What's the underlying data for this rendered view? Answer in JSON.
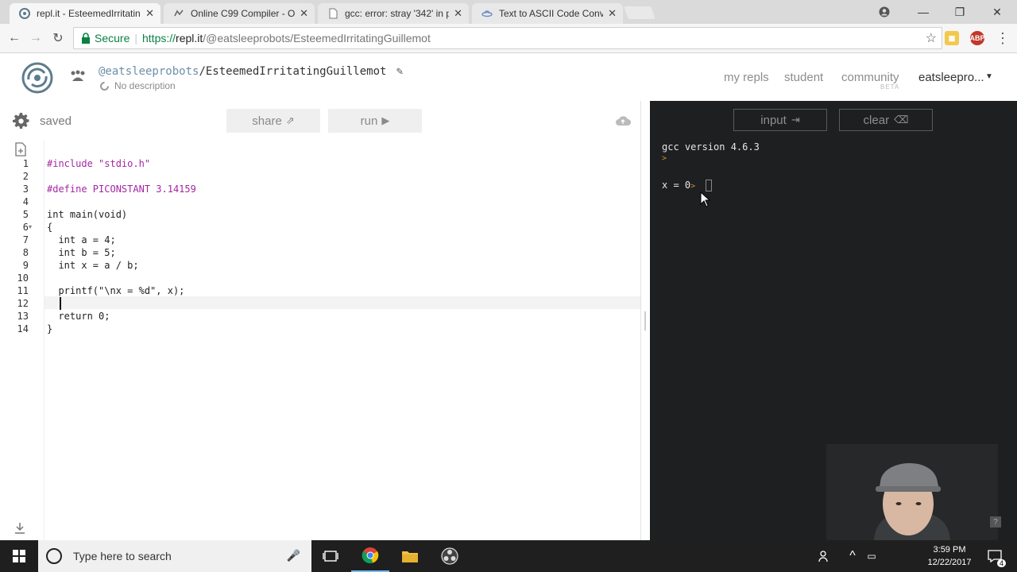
{
  "browser": {
    "tabs": [
      {
        "title": "repl.it - EsteemedIrritatin",
        "icon": "replit-icon"
      },
      {
        "title": "Online C99 Compiler - O",
        "icon": "compiler-icon"
      },
      {
        "title": "gcc: error: stray '342' in p",
        "icon": "doc-icon"
      },
      {
        "title": "Text to ASCII Code Conv",
        "icon": "ufo-icon"
      }
    ],
    "secure_label": "Secure",
    "url_prefix": "https://",
    "url_host": "repl.it",
    "url_path": "/@eatsleeprobots/EsteemedIrritatingGuillemot",
    "ext_abp": "ABP"
  },
  "header": {
    "owner": "@eatsleeprobots",
    "repl_name": "EsteemedIrritatingGuillemot",
    "description": "No description",
    "nav": {
      "my_repls": "my repls",
      "student": "student",
      "community": "community",
      "community_badge": "BETA",
      "user": "eatsleepro..."
    }
  },
  "editor": {
    "status": "saved",
    "share_label": "share",
    "run_label": "run",
    "lines": [
      {
        "n": "1",
        "text": "#include \"stdio.h\""
      },
      {
        "n": "2",
        "text": ""
      },
      {
        "n": "3",
        "text": "#define PICONSTANT 3.14159"
      },
      {
        "n": "4",
        "text": ""
      },
      {
        "n": "5",
        "text": "int main(void)"
      },
      {
        "n": "6",
        "text": "{"
      },
      {
        "n": "7",
        "text": "  int a = 4;"
      },
      {
        "n": "8",
        "text": "  int b = 5;"
      },
      {
        "n": "9",
        "text": "  int x = a / b;"
      },
      {
        "n": "10",
        "text": ""
      },
      {
        "n": "11",
        "text": "  printf(\"\\nx = %d\", x);"
      },
      {
        "n": "12",
        "text": ""
      },
      {
        "n": "13",
        "text": "  return 0;"
      },
      {
        "n": "14",
        "text": "}"
      }
    ]
  },
  "console": {
    "input_label": "input",
    "clear_label": "clear",
    "version": "gcc version 4.6.3",
    "prompt": ">",
    "output": "x = 0",
    "output_prompt": ">"
  },
  "taskbar": {
    "search_placeholder": "Type here to search",
    "time": "3:59 PM",
    "date": "12/22/2017",
    "notification_count": "4"
  }
}
